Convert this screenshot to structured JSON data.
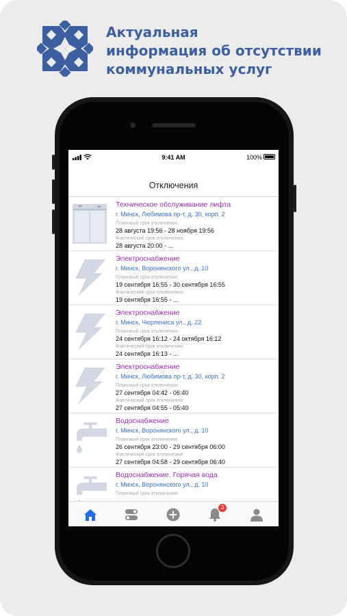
{
  "promo": {
    "headline": [
      "Актуальная",
      "информация об отсутствии",
      "коммунальных услуг"
    ],
    "brand_color": "#3b5fa1"
  },
  "status_bar": {
    "time": "9:41 AM",
    "battery": "100%"
  },
  "nav": {
    "title": "Отключения"
  },
  "colors": {
    "title": "#9b2fb0",
    "address": "#3770c7",
    "icon_tint": "#d1d7e3",
    "tab_active": "#1f6ee8",
    "tab_inactive": "#8a8a8a",
    "badge": "#f03a3a"
  },
  "outages": [
    {
      "icon": "elevator-icon",
      "title": "Техническое обслуживание лифта",
      "address": "г. Минск, Любимова пр-т, д. 30, корп. 2",
      "planned_label": "Плановый срок отключения:",
      "planned": "28 августа 19:56 - 28 ноября 19:56",
      "actual_label": "Фактический срок отключения:",
      "actual": "28 августа 20:00 - ..."
    },
    {
      "icon": "lightning-icon",
      "title": "Электроснабжение",
      "address": "г. Минск, Воронянского ул., д. 10",
      "planned_label": "Плановый срок отключения:",
      "planned": "19 сентября 16:55 - 30 сентября 16:55",
      "actual_label": "Фактический срок отключения:",
      "actual": "19 сентября 16:55 - ..."
    },
    {
      "icon": "lightning-icon",
      "title": "Электроснабжение",
      "address": "г. Минск, Чюрлениса ул., д. 22",
      "planned_label": "Плановый срок отключения:",
      "planned": "24 сентября 16:12 - 24 октября 16:12",
      "actual_label": "Фактический срок отключения:",
      "actual": "24 сентября 16:13 - ..."
    },
    {
      "icon": "lightning-icon",
      "title": "Электроснабжение",
      "address": "г. Минск, Любимова пр-т, д. 30, корп. 2",
      "planned_label": "Плановый срок отключения:",
      "planned": "27 сентября 04:42 - 06:40",
      "actual_label": "Фактический срок отключения:",
      "actual": "27 сентября 04:55 - 05:40"
    },
    {
      "icon": "water-tap-icon",
      "title": "Водоснабжение",
      "address": "г. Минск, Воронянского ул., д. 10",
      "planned_label": "Плановый срок отключения:",
      "planned": "26 сентября 23:00 - 29 сентября 06:00",
      "actual_label": "Фактический срок отключения:",
      "actual": "27 сентября 04:58 - 29 сентября 06:40"
    },
    {
      "icon": "water-tap-icon",
      "title": "Водоснабжение. Горячая вода",
      "address": "г. Минск, Воронянского ул., д. 10",
      "planned_label": "Плановый срок отключения:",
      "planned": "",
      "actual_label": "",
      "actual": ""
    }
  ],
  "tabs": [
    {
      "icon": "home-icon",
      "active": true
    },
    {
      "icon": "toggles-icon",
      "active": false
    },
    {
      "icon": "plus-circle-icon",
      "active": false
    },
    {
      "icon": "bell-icon",
      "active": false,
      "badge": "3"
    },
    {
      "icon": "person-icon",
      "active": false
    }
  ]
}
